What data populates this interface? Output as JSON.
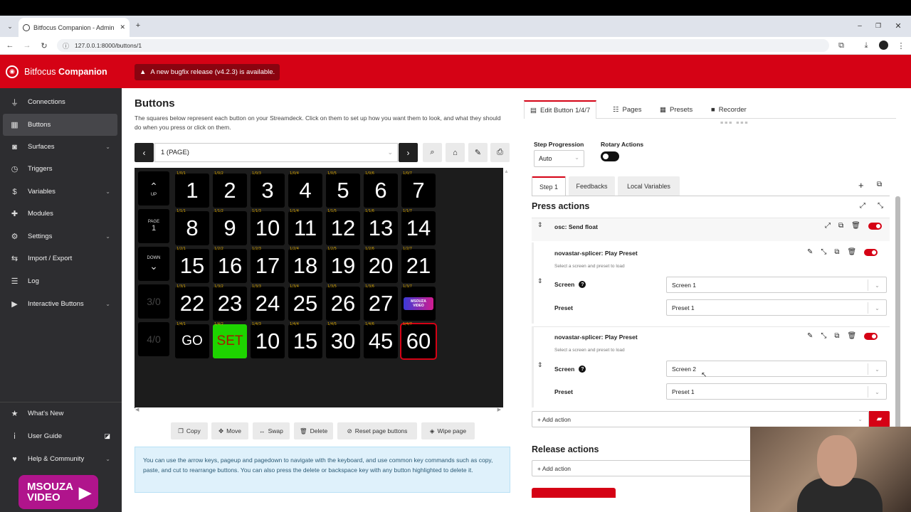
{
  "browser": {
    "tab_title": "Bitfocus Companion - Admin",
    "url": "127.0.0.1:8000/buttons/1"
  },
  "app": {
    "brand_a": "Bitfocus",
    "brand_b": "Companion",
    "notice": "A new bugfix release (v4.2.3) is available."
  },
  "sidebar": {
    "items": [
      {
        "label": "Connections",
        "icon": "plug-icon"
      },
      {
        "label": "Buttons",
        "icon": "grid-icon"
      },
      {
        "label": "Surfaces",
        "icon": "gamepad-icon"
      },
      {
        "label": "Triggers",
        "icon": "clock-icon"
      },
      {
        "label": "Variables",
        "icon": "dollar-icon"
      },
      {
        "label": "Modules",
        "icon": "puzzle-icon"
      },
      {
        "label": "Settings",
        "icon": "gear-icon"
      },
      {
        "label": "Import / Export",
        "icon": "import-icon"
      },
      {
        "label": "Log",
        "icon": "log-icon"
      },
      {
        "label": "Interactive Buttons",
        "icon": "play-icon"
      }
    ],
    "bottom": [
      {
        "label": "What's New",
        "icon": "star-icon"
      },
      {
        "label": "User Guide",
        "icon": "info-icon"
      },
      {
        "label": "Help & Community",
        "icon": "heart-icon"
      }
    ],
    "overlay_logo_a": "MSOUZA",
    "overlay_logo_b": "VIDEO"
  },
  "main": {
    "title": "Buttons",
    "description": "The squares below represent each button on your Streamdeck. Click on them to set up how you want them to look, and what they should do when you press or click on them.",
    "page_select": "1 (PAGE)",
    "nav": {
      "up": "UP",
      "page": "PAGE",
      "page_num": "1",
      "down": "DOWN",
      "r4": "3/0",
      "r5": "4/0"
    },
    "rows": [
      {
        "cells": [
          {
            "lb": "1/0/1",
            "t": "1"
          },
          {
            "lb": "1/0/2",
            "t": "2"
          },
          {
            "lb": "1/0/3",
            "t": "3"
          },
          {
            "lb": "1/0/4",
            "t": "4"
          },
          {
            "lb": "1/0/5",
            "t": "5"
          },
          {
            "lb": "1/0/6",
            "t": "6"
          },
          {
            "lb": "1/0/7",
            "t": "7"
          }
        ]
      },
      {
        "cells": [
          {
            "lb": "1/1/1",
            "t": "8"
          },
          {
            "lb": "1/1/2",
            "t": "9"
          },
          {
            "lb": "1/1/3",
            "t": "10"
          },
          {
            "lb": "1/1/4",
            "t": "11"
          },
          {
            "lb": "1/1/5",
            "t": "12"
          },
          {
            "lb": "1/1/6",
            "t": "13"
          },
          {
            "lb": "1/1/7",
            "t": "14"
          }
        ]
      },
      {
        "cells": [
          {
            "lb": "1/2/1",
            "t": "15"
          },
          {
            "lb": "1/2/2",
            "t": "16"
          },
          {
            "lb": "1/2/3",
            "t": "17"
          },
          {
            "lb": "1/2/4",
            "t": "18"
          },
          {
            "lb": "1/2/5",
            "t": "19"
          },
          {
            "lb": "1/2/6",
            "t": "20"
          },
          {
            "lb": "1/2/7",
            "t": "21"
          }
        ]
      },
      {
        "cells": [
          {
            "lb": "1/3/1",
            "t": "22"
          },
          {
            "lb": "1/3/2",
            "t": "23"
          },
          {
            "lb": "1/3/3",
            "t": "24"
          },
          {
            "lb": "1/3/4",
            "t": "25"
          },
          {
            "lb": "1/3/5",
            "t": "26"
          },
          {
            "lb": "1/3/6",
            "t": "27"
          },
          {
            "lb": "1/3/7",
            "t": "MSOUZA VIDEO"
          }
        ]
      },
      {
        "cells": [
          {
            "lb": "1/4/1",
            "t": "GO"
          },
          {
            "lb": "1/4/2",
            "t": "SET"
          },
          {
            "lb": "1/4/3",
            "t": "10"
          },
          {
            "lb": "1/4/4",
            "t": "15"
          },
          {
            "lb": "1/4/5",
            "t": "30"
          },
          {
            "lb": "1/4/6",
            "t": "45"
          },
          {
            "lb": "1/4/7",
            "t": "60"
          }
        ]
      }
    ],
    "actions": {
      "copy": "Copy",
      "move": "Move",
      "swap": "Swap",
      "delete": "Delete",
      "reset": "Reset page buttons",
      "wipe": "Wipe page"
    },
    "info": "You can use the arrow keys, pageup and pagedown to navigate with the keyboard, and use common key commands such as copy, paste, and cut to rearrange buttons. You can also press the delete or backspace key with any button highlighted to delete it.",
    "colors": {
      "set_bg": "#1ed400",
      "selected_border": "#d50215"
    }
  },
  "panel": {
    "tabs": {
      "edit": "Edit Button 1/4/7",
      "pages": "Pages",
      "presets": "Presets",
      "recorder": "Recorder"
    },
    "step_progression_label": "Step Progression",
    "step_progression_value": "Auto",
    "rotary_label": "Rotary Actions",
    "subtabs": {
      "step1": "Step 1",
      "feedbacks": "Feedbacks",
      "local": "Local Variables"
    },
    "press_title": "Press actions",
    "action0": "osc: Send float",
    "action1": {
      "title": "novastar-splicer: Play Preset",
      "sub": "Select a screen and preset to load",
      "screen_label": "Screen",
      "screen_value": "Screen 1",
      "preset_label": "Preset",
      "preset_value": "Preset 1"
    },
    "action2": {
      "title": "novastar-splicer: Play Preset",
      "sub": "Select a screen and preset to load",
      "screen_label": "Screen",
      "screen_value": "Screen 2",
      "preset_label": "Preset",
      "preset_value": "Preset 1"
    },
    "add_action": "+ Add action",
    "release_title": "Release actions",
    "add_action2": "+ Add action"
  }
}
